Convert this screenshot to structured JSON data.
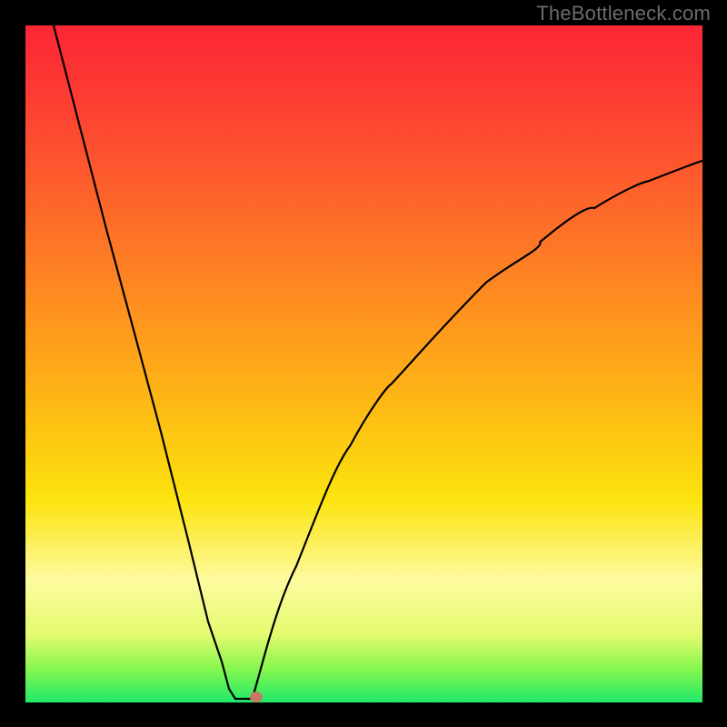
{
  "watermark": {
    "text": "TheBottleneck.com"
  },
  "gradient": {
    "colors": [
      "#fc2634",
      "#fd3b33",
      "#fd5a2d",
      "#fd7b25",
      "#fe9c1c",
      "#fdbf13",
      "#fce30e",
      "#fdfb9f",
      "#e4fa6e",
      "#87f74f",
      "#1fe969"
    ]
  },
  "chart_data": {
    "type": "line",
    "title": "",
    "xlabel": "",
    "ylabel": "",
    "xlim": [
      0,
      100
    ],
    "ylim": [
      0,
      100
    ],
    "legend": null,
    "grid": false,
    "note": "V-shaped bottleneck curve. Approximate y = |f(x)| shape with cusp near minimum. Values read from pixel positions (x,y in 0–100 plot coords).",
    "series": [
      {
        "name": "bottleneck-curve-left",
        "x": [
          4.2,
          8,
          12,
          16,
          20,
          24,
          27,
          29,
          30,
          31
        ],
        "values": [
          100,
          85,
          70,
          55,
          40,
          24,
          12,
          6,
          2,
          0.5
        ]
      },
      {
        "name": "bottleneck-floor",
        "x": [
          31,
          33.5
        ],
        "values": [
          0.5,
          0.5
        ]
      },
      {
        "name": "bottleneck-curve-right",
        "x": [
          33.5,
          36,
          40,
          44,
          48,
          54,
          60,
          68,
          76,
          84,
          92,
          100
        ],
        "values": [
          0.5,
          8,
          20,
          30,
          38,
          47,
          54,
          62,
          68,
          73,
          77,
          80
        ]
      }
    ],
    "marker": {
      "name": "optimal-point",
      "x": 34.1,
      "y": 0.8,
      "color": "#c57a60",
      "rx": 6,
      "ry": 5
    }
  }
}
